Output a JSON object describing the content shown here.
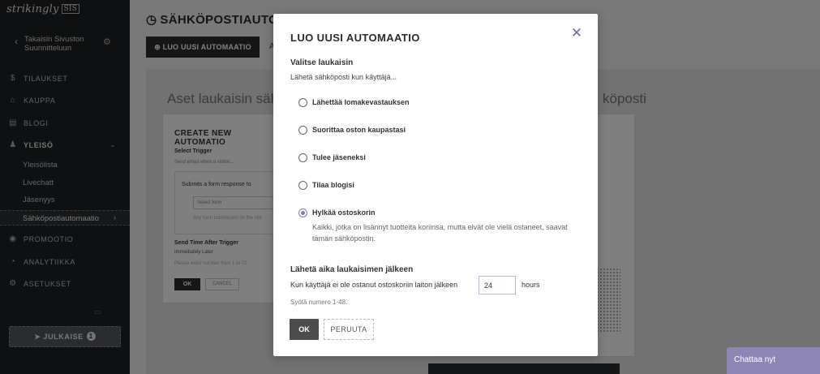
{
  "sidebar": {
    "logo": "strikingly",
    "logo_mark": "SIS",
    "back_line1": "Takaisin Sivuston",
    "back_line2": "Suunnitteluun",
    "nav": [
      {
        "label": "TILAUKSET",
        "icon": "dollar-icon"
      },
      {
        "label": "KAUPPA",
        "icon": "store-icon"
      },
      {
        "label": "BLOGI",
        "icon": "blog-icon"
      },
      {
        "label": "YLEISÖ",
        "icon": "people-icon"
      },
      {
        "label": "PROMOOTIO",
        "icon": "promo-icon"
      },
      {
        "label": "ANALYTIIKKA",
        "icon": "analytics-icon"
      },
      {
        "label": "ASETUKSET",
        "icon": "settings-icon"
      }
    ],
    "sub_items": [
      "Yleisölista",
      "Livechatt",
      "Jäsenyys",
      "Sähköpostiautomaatio"
    ],
    "publish_label": "JULKAISE",
    "publish_badge": "1"
  },
  "main": {
    "page_title": "SÄHKÖPOSTIAUTOMA",
    "new_button": "LUO UUSI AUTOMAATIO",
    "tab_fragment": "A",
    "panel_heading_left": "Aset laukaisin sähkö",
    "panel_heading_right": "köposti",
    "card": {
      "title": "CREATE NEW AUTOMATIO",
      "select_trigger": "Select Trigger",
      "trigger_hint": "Send email when a visitor...",
      "option": "Submits a form response to",
      "field_placeholder": "Select form",
      "field_hint": "Any form submission on the site",
      "send_time": "Send Time After Trigger",
      "send_options": "Immediately   Later",
      "send_hint": "Please enter number from 1 to 72",
      "ok": "OK",
      "cancel": "CANCEL"
    }
  },
  "modal": {
    "title": "LUO UUSI AUTOMAATIO",
    "section_trigger": "Valitse laukaisin",
    "trigger_sub": "Lähetä sähköposti kun käyttäjä...",
    "options": [
      {
        "label": "Lähettää lomakevastauksen",
        "checked": false
      },
      {
        "label": "Suorittaa oston kaupastasi",
        "checked": false
      },
      {
        "label": "Tulee jäseneksi",
        "checked": false
      },
      {
        "label": "Tilaa blogisi",
        "checked": false
      },
      {
        "label": "Hylkää ostoskorin",
        "checked": true
      }
    ],
    "selected_description": "Kaikki, jotka on lisännyt tuotteita koriinsa, mutta eivät ole vielä ostaneet, saavat tämän sähköpostin.",
    "section_delay": "Lähetä aika laukaisimen jälkeen",
    "delay_text": "Kun käyttäjä ei ole ostanut ostoskoriin laiton jälkeen",
    "delay_value": "24",
    "delay_unit": "hours",
    "hint": "Syötä numero 1-48.",
    "ok_label": "OK",
    "cancel_label": "PERUUTA"
  },
  "chat": {
    "label": "Chattaa nyt"
  },
  "colors": {
    "accent": "#7e7bb0",
    "chat": "#8f86b8",
    "sidebar": "#1f2123"
  }
}
